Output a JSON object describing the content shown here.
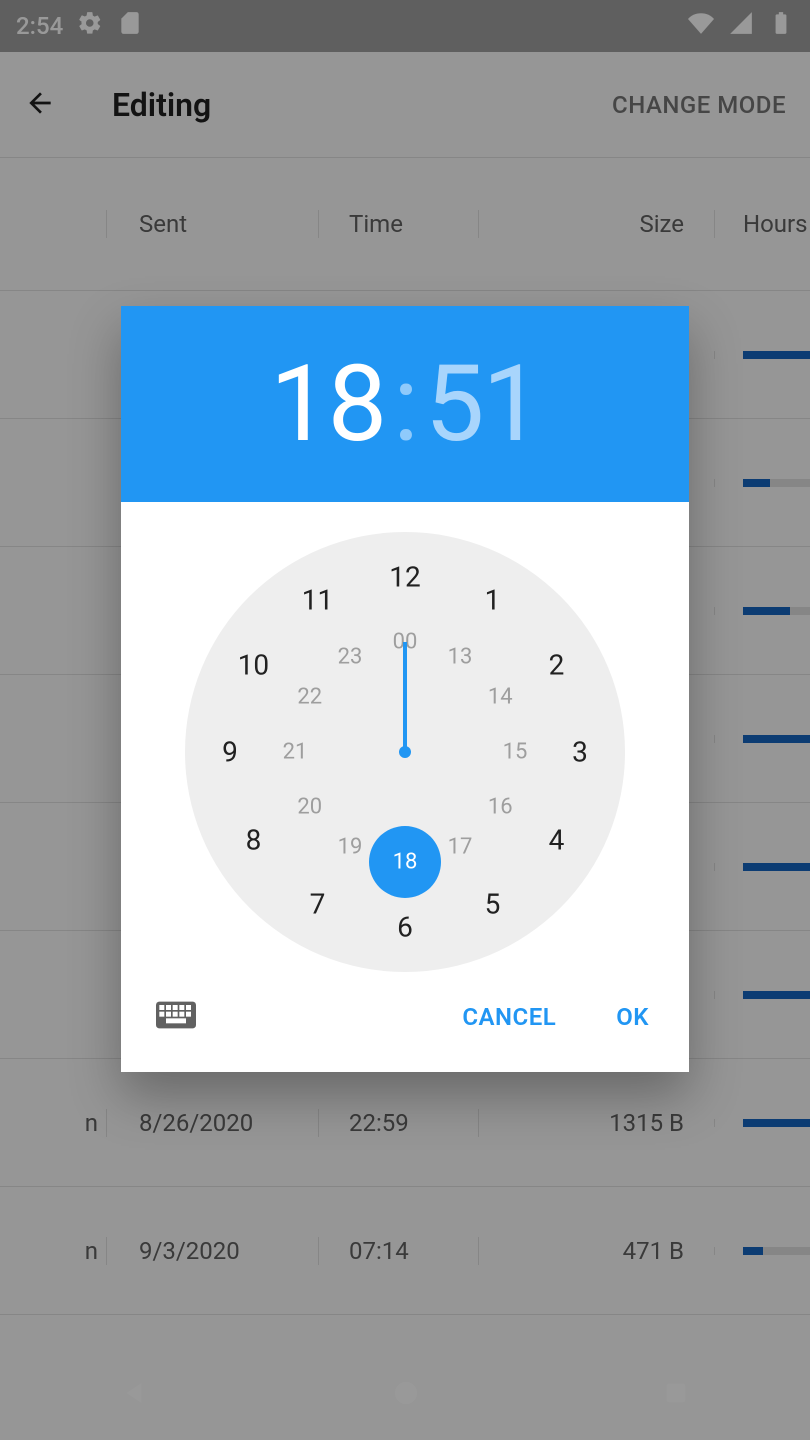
{
  "statusbar": {
    "time": "2:54"
  },
  "appbar": {
    "title": "Editing",
    "action": "CHANGE MODE"
  },
  "table": {
    "headers": {
      "sent": "Sent",
      "time": "Time",
      "size": "Size",
      "hours": "Hours"
    },
    "rows": [
      {
        "name": "",
        "sent": "",
        "time": "",
        "size": "",
        "barPct": 100
      },
      {
        "name": "",
        "sent": "",
        "time": "",
        "size": "",
        "barPct": 40
      },
      {
        "name": "",
        "sent": "",
        "time": "",
        "size": "",
        "barPct": 70
      },
      {
        "name": "",
        "sent": "",
        "time": "",
        "size": "",
        "barPct": 100
      },
      {
        "name": "",
        "sent": "",
        "time": "",
        "size": "",
        "barPct": 100
      },
      {
        "name": "",
        "sent": "",
        "time": "",
        "size": "",
        "barPct": 100
      },
      {
        "name": "n",
        "sent": "8/26/2020",
        "time": "22:59",
        "size": "1315 B",
        "barPct": 100
      },
      {
        "name": "n",
        "sent": "9/3/2020",
        "time": "07:14",
        "size": "471 B",
        "barPct": 30
      }
    ]
  },
  "timepicker": {
    "hours": "18",
    "minutes": "51",
    "selectedHour": 18,
    "outer": [
      "12",
      "1",
      "2",
      "3",
      "4",
      "5",
      "6",
      "7",
      "8",
      "9",
      "10",
      "11"
    ],
    "inner": [
      "00",
      "13",
      "14",
      "15",
      "16",
      "17",
      "18",
      "19",
      "20",
      "21",
      "22",
      "23"
    ],
    "cancel": "CANCEL",
    "ok": "OK"
  }
}
